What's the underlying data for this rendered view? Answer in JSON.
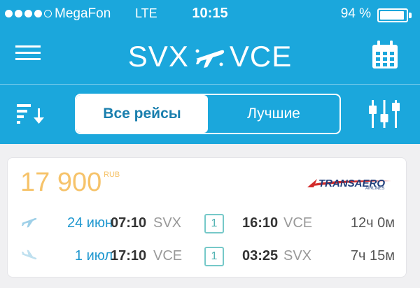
{
  "status_bar": {
    "carrier": "MegaFon",
    "network": "LTE",
    "time": "10:15",
    "battery": "94 %",
    "battery_level": 0.94,
    "signal_filled": 4,
    "signal_total": 5
  },
  "nav": {
    "origin": "SVX",
    "destination": "VCE"
  },
  "tabs": {
    "all_label": "Все рейсы",
    "best_label": "Лучшие",
    "selected": "all"
  },
  "result": {
    "price": "17 900",
    "currency": "RUB",
    "airline_logo": "TRANSAERO",
    "airline_logo_sub": "AIRLINES",
    "outbound": {
      "date": "24 июн",
      "dep_time": "07:10",
      "dep_code": "SVX",
      "stops": "1",
      "arr_time": "16:10",
      "arr_code": "VCE",
      "duration": "12ч 0м"
    },
    "return": {
      "date": "1 июл",
      "dep_time": "17:10",
      "dep_code": "VCE",
      "stops": "1",
      "arr_time": "03:25",
      "arr_code": "SVX",
      "duration": "7ч 15м"
    }
  },
  "colors": {
    "header_bg": "#1ba7dc",
    "price": "#f6c36a",
    "date": "#1e97cf",
    "stops_badge": "#4db1b1"
  },
  "icons": [
    "menu-icon",
    "plane-icon",
    "calendar-icon",
    "sort-icon",
    "filter-icon",
    "departure-plane-icon",
    "arrival-plane-icon"
  ]
}
